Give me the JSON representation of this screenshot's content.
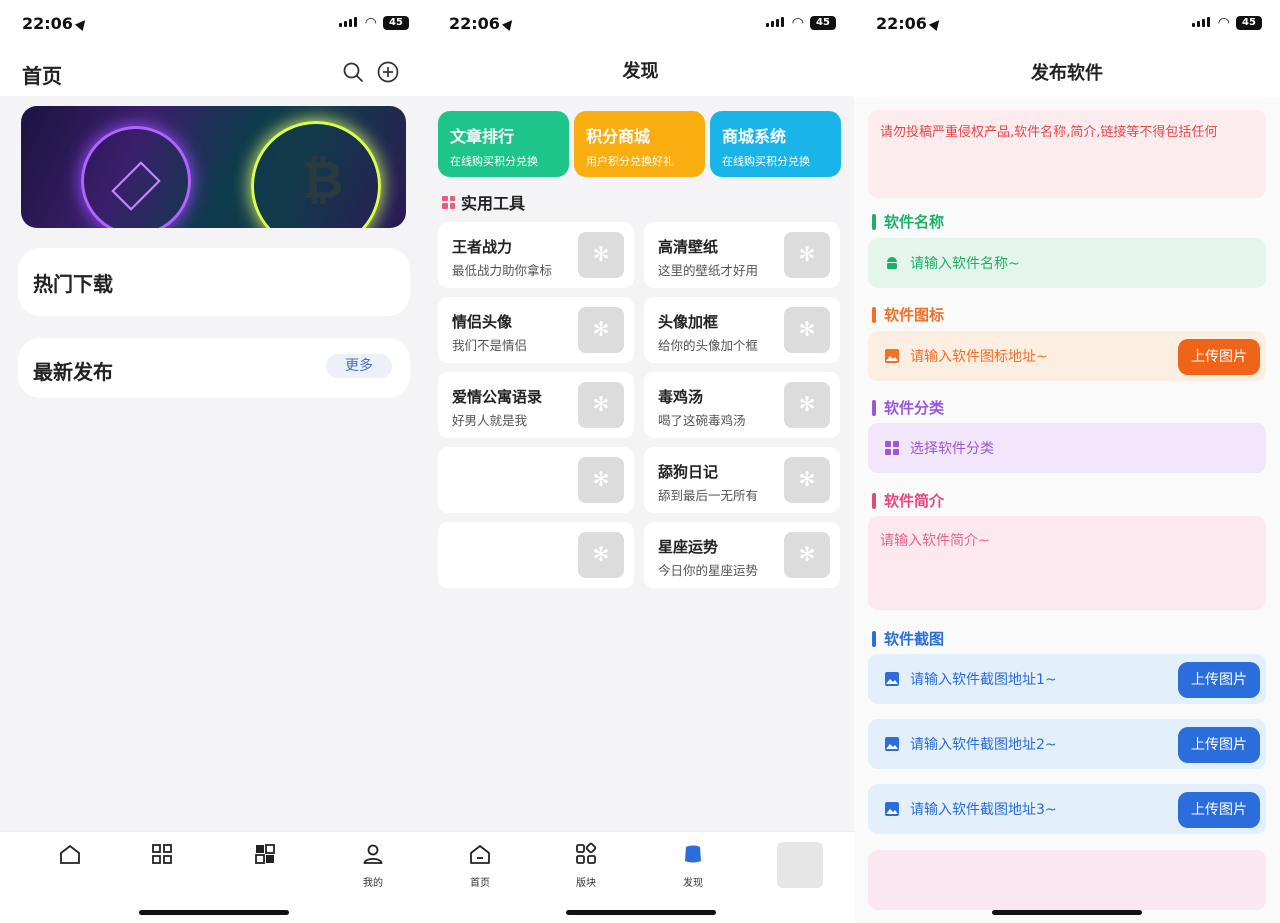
{
  "status": {
    "time": "22:06",
    "battery": "45"
  },
  "home": {
    "title": "首页",
    "sections": [
      {
        "title": "热门下载"
      },
      {
        "title": "最新发布",
        "more": "更多"
      }
    ],
    "tabs": [
      {
        "label": ""
      },
      {
        "label": ""
      },
      {
        "label": ""
      },
      {
        "label": "我的"
      }
    ]
  },
  "discover": {
    "title": "发现",
    "promos": [
      {
        "title": "文章排行",
        "subtitle": "在线购买积分兑换",
        "color": "#1ec58b"
      },
      {
        "title": "积分商城",
        "subtitle": "用户积分兑换好礼",
        "color": "#f8ae11"
      },
      {
        "title": "商城系统",
        "subtitle": "在线购买积分兑换",
        "color": "#1ab5e8"
      }
    ],
    "section_title": "实用工具",
    "tools": [
      {
        "title": "王者战力",
        "subtitle": "最低战力助你拿标"
      },
      {
        "title": "高清壁纸",
        "subtitle": "这里的壁纸才好用"
      },
      {
        "title": "情侣头像",
        "subtitle": "我们不是情侣"
      },
      {
        "title": "头像加框",
        "subtitle": "给你的头像加个框"
      },
      {
        "title": "爱情公寓语录",
        "subtitle": "好男人就是我"
      },
      {
        "title": "毒鸡汤",
        "subtitle": "喝了这碗毒鸡汤"
      },
      {
        "title": "",
        "subtitle": ""
      },
      {
        "title": "舔狗日记",
        "subtitle": "舔到最后一无所有"
      },
      {
        "title": "",
        "subtitle": ""
      },
      {
        "title": "星座运势",
        "subtitle": "今日你的星座运势"
      }
    ],
    "tabs": [
      {
        "label": "首页"
      },
      {
        "label": "版块"
      },
      {
        "label": "发现"
      },
      {
        "label": ""
      }
    ]
  },
  "publish": {
    "title": "发布软件",
    "notice": "请勿投稿严重侵权产品,软件名称,简介,链接等不得包括任何",
    "fields": {
      "name": {
        "label": "软件名称",
        "placeholder": "请输入软件名称~",
        "color": "#1eb06a",
        "bg": "#e4f5ec"
      },
      "icon": {
        "label": "软件图标",
        "placeholder": "请输入软件图标地址~",
        "upload": "上传图片",
        "color": "#f07028",
        "bg": "#fdeee2"
      },
      "category": {
        "label": "软件分类",
        "placeholder": "选择软件分类",
        "color": "#9a57d9",
        "bg": "#f1e6fb"
      },
      "intro": {
        "label": "软件简介",
        "placeholder": "请输入软件简介~",
        "color": "#e5487a"
      },
      "screenshots": {
        "label": "软件截图",
        "color": "#2a6ddb",
        "bg": "#e3f0fb",
        "items": [
          {
            "placeholder": "请输入软件截图地址1~",
            "upload": "上传图片"
          },
          {
            "placeholder": "请输入软件截图地址2~",
            "upload": "上传图片"
          },
          {
            "placeholder": "请输入软件截图地址3~",
            "upload": "上传图片"
          }
        ]
      }
    }
  }
}
